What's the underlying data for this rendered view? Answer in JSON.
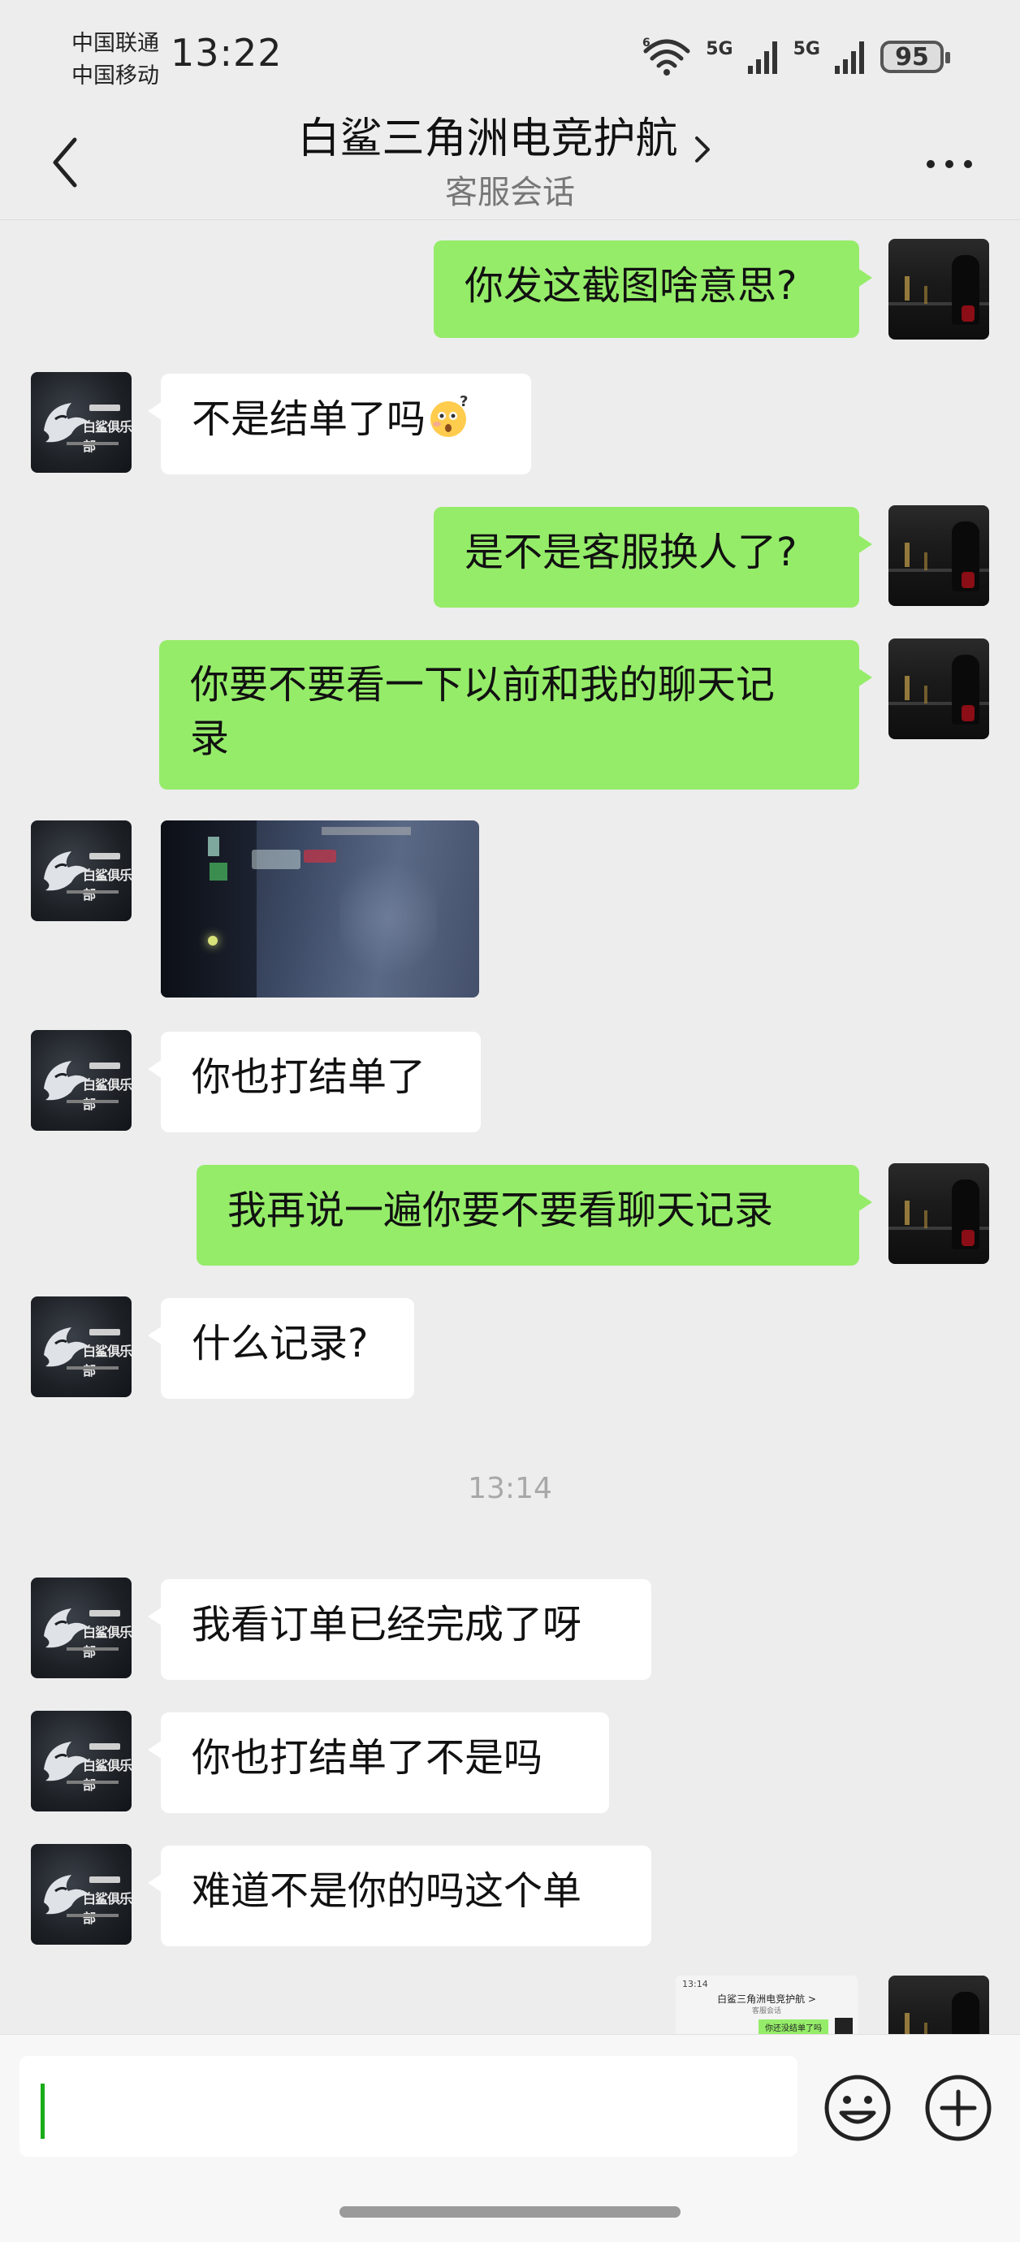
{
  "status_bar": {
    "carrier1": "中国联通",
    "carrier2": "中国移动",
    "time": "13:22",
    "net1": "5G",
    "net2": "5G",
    "battery": "95"
  },
  "header": {
    "title": "白鲨三角洲电竞护航",
    "subtitle": "客服会话"
  },
  "messages": {
    "m1": "你发这截图啥意思?",
    "m2": "不是结单了吗",
    "m3": "是不是客服换人了?",
    "m4a": "你要不要看一下以前和我的聊天记",
    "m4b": "录",
    "m6": "你也打结单了",
    "m7": "我再说一遍你要不要看聊天记录",
    "m8": "什么记录?",
    "time_sep": "13:14",
    "m9": "我看订单已经完成了呀",
    "m10": "你也打结单了不是吗",
    "m11": "难道不是你的吗这个单"
  },
  "mini_screenshot": {
    "time": "13:14",
    "title": "白鲨三角洲电竞护航 >",
    "subtitle": "客服会话",
    "bubble": "你还没结单了吗"
  },
  "colors": {
    "self_bubble": "#95EC69",
    "other_bubble": "#FFFFFF",
    "background": "#EDEDED",
    "caret": "#1AAD19"
  }
}
